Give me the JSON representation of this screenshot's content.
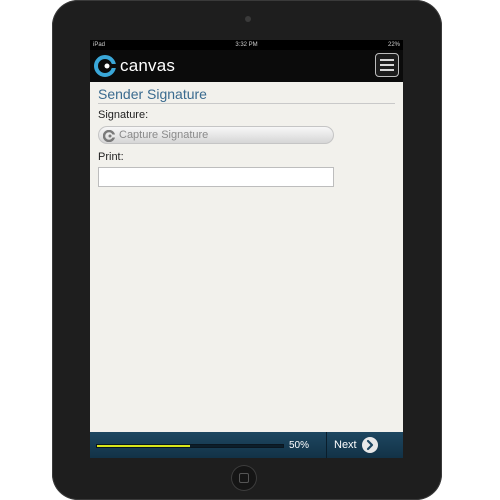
{
  "status_bar": {
    "carrier": "iPad",
    "time": "3:32 PM",
    "battery": "22%"
  },
  "header": {
    "brand": "canvas"
  },
  "form": {
    "title": "Sender Signature",
    "signature_label": "Signature:",
    "capture_button_label": "Capture Signature",
    "print_label": "Print:",
    "print_value": ""
  },
  "footer": {
    "progress_percent": 50,
    "progress_label": "50%",
    "next_label": "Next"
  },
  "colors": {
    "accent": "#3a6b8f",
    "progress_fill": "#d8e619",
    "footer_bg": "#1e4761"
  },
  "icons": [
    "canvas-logo-icon",
    "menu-icon",
    "signature-capture-icon",
    "next-arrow-icon"
  ]
}
